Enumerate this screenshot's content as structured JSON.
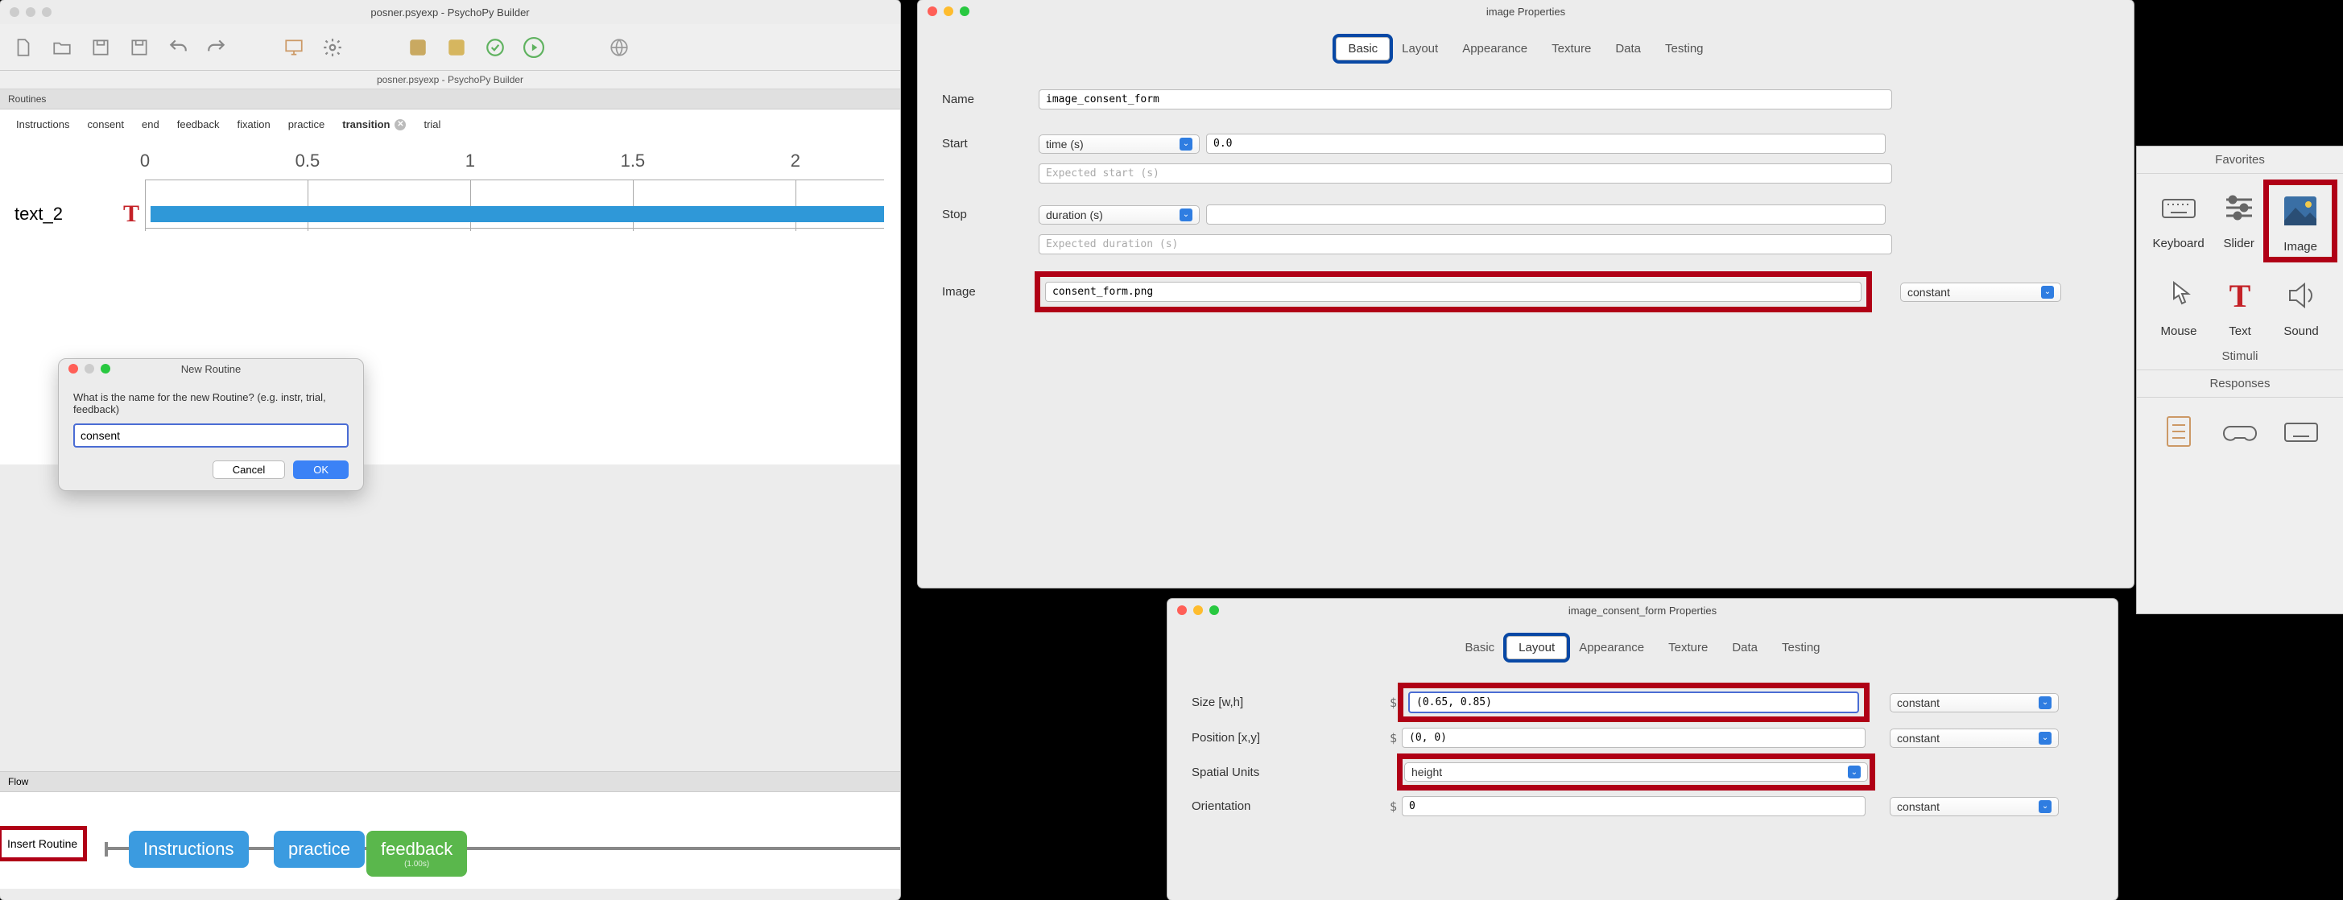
{
  "builder": {
    "title": "posner.psyexp - PsychoPy Builder",
    "subtitle": "posner.psyexp - PsychoPy Builder",
    "routines_label": "Routines",
    "tabs": [
      "Instructions",
      "consent",
      "end",
      "feedback",
      "fixation",
      "practice",
      "transition",
      "trial"
    ],
    "active_tab": "transition",
    "ruler": [
      "0",
      "0.5",
      "1",
      "1.5",
      "2"
    ],
    "component": "text_2",
    "flow_label": "Flow",
    "insert_btn": "Insert Routine",
    "flow_nodes": [
      "Instructions",
      "practice",
      "feedback"
    ],
    "feedback_time": "(1.00s)"
  },
  "new_routine": {
    "title": "New Routine",
    "prompt": "What is the name for the new Routine? (e.g. instr, trial, feedback)",
    "value": "consent",
    "cancel": "Cancel",
    "ok": "OK"
  },
  "image_props": {
    "title": "image Properties",
    "tabs": [
      "Basic",
      "Layout",
      "Appearance",
      "Texture",
      "Data",
      "Testing"
    ],
    "active": "Basic",
    "name_lbl": "Name",
    "name_val": "image_consent_form",
    "start_lbl": "Start",
    "start_type": "time (s)",
    "start_val": "0.0",
    "exp_start_ph": "Expected start (s)",
    "stop_lbl": "Stop",
    "stop_type": "duration (s)",
    "exp_dur_ph": "Expected duration (s)",
    "image_lbl": "Image",
    "image_val": "consent_form.png",
    "const": "constant"
  },
  "layout_props": {
    "title": "image_consent_form Properties",
    "tabs": [
      "Basic",
      "Layout",
      "Appearance",
      "Texture",
      "Data",
      "Testing"
    ],
    "active": "Layout",
    "size_lbl": "Size [w,h]",
    "size_val": "(0.65, 0.85)",
    "pos_lbl": "Position [x,y]",
    "pos_val": "(0, 0)",
    "units_lbl": "Spatial Units",
    "units_val": "height",
    "ori_lbl": "Orientation",
    "ori_val": "0",
    "const": "constant"
  },
  "components": {
    "favorites": "Favorites",
    "stimuli": "Stimuli",
    "responses": "Responses",
    "items": {
      "keyboard": "Keyboard",
      "slider": "Slider",
      "image": "Image",
      "mouse": "Mouse",
      "text": "Text",
      "sound": "Sound"
    }
  }
}
